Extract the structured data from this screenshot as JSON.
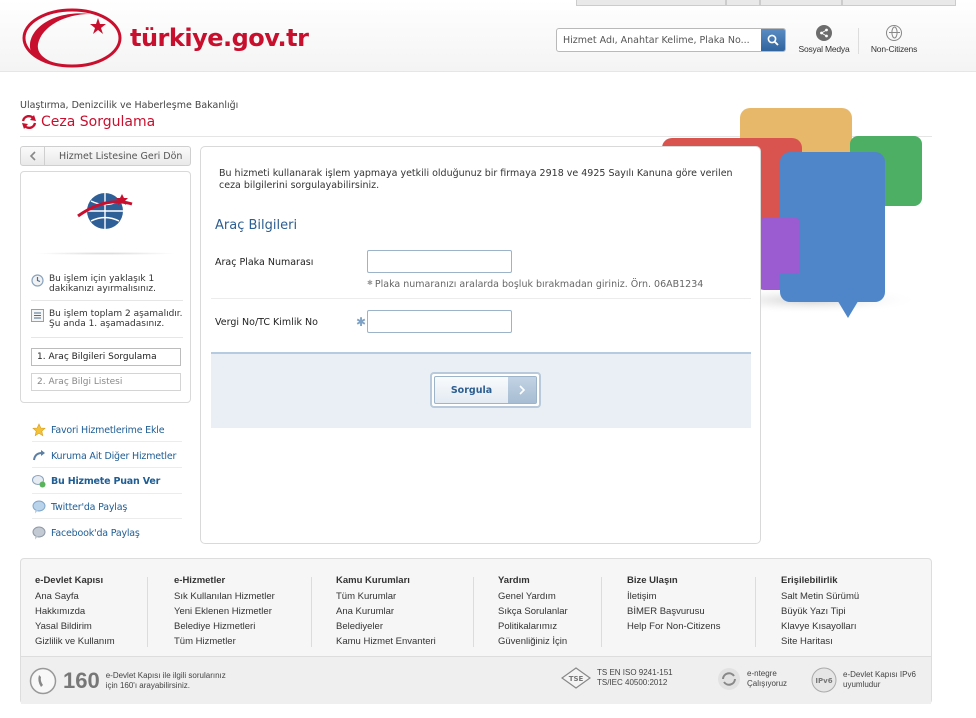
{
  "header": {
    "logo_text": "türkiye.gov.tr",
    "search_placeholder": "Hizmet Adı, Anahtar Kelime, Plaka No...",
    "social_label": "Sosyal Medya",
    "noncitizens_label": "Non-Citizens"
  },
  "page": {
    "ministry": "Ulaştırma, Denizcilik ve Haberleşme Bakanlığı",
    "title": "Ceza Sorgulama"
  },
  "sidebar": {
    "back_label": "Hizmet Listesine Geri Dön",
    "time_info": "Bu işlem için yaklaşık 1 dakikanızı ayırmalısınız.",
    "steps_info": "Bu işlem toplam 2 aşamalıdır. Şu anda 1. aşamadasınız.",
    "steps": [
      "1.  Araç Bilgileri Sorgulama",
      "2.  Araç Bilgi Listesi"
    ],
    "links": [
      "Favori Hizmetlerime Ekle",
      "Kuruma Ait Diğer Hizmetler",
      "Bu Hizmete Puan Ver",
      "Twitter'da Paylaş",
      "Facebook'da Paylaş"
    ]
  },
  "form": {
    "intro": "Bu hizmeti kullanarak işlem yapmaya yetkili olduğunuz bir firmaya 2918 ve 4925 Sayılı Kanuna göre verilen ceza bilgilerini sorgulayabilirsiniz.",
    "section_title": "Araç Bilgileri",
    "plate_label": "Araç Plaka Numarası",
    "plate_value": "",
    "plate_hint": "Plaka numaranızı aralarda boşluk bırakmadan giriniz. Örn. 06AB1234",
    "tax_label": "Vergi No/TC Kimlik No",
    "tax_value": "",
    "submit_label": "Sorgula"
  },
  "footer": {
    "columns": [
      {
        "title": "e-Devlet Kapısı",
        "links": [
          "Ana Sayfa",
          "Hakkımızda",
          "Yasal Bildirim",
          "Gizlilik ve Kullanım"
        ]
      },
      {
        "title": "e-Hizmetler",
        "links": [
          "Sık Kullanılan Hizmetler",
          "Yeni Eklenen Hizmetler",
          "Belediye Hizmetleri",
          "Tüm Hizmetler"
        ]
      },
      {
        "title": "Kamu Kurumları",
        "links": [
          "Tüm Kurumlar",
          "Ana Kurumlar",
          "Belediyeler",
          "Kamu Hizmet Envanteri"
        ]
      },
      {
        "title": "Yardım",
        "links": [
          "Genel Yardım",
          "Sıkça Sorulanlar",
          "Politikalarımız",
          "Güvenliğiniz İçin"
        ]
      },
      {
        "title": "Bize Ulaşın",
        "links": [
          "İletişim",
          "BİMER Başvurusu",
          "Help For Non-Citizens"
        ]
      },
      {
        "title": "Erişilebilirlik",
        "links": [
          "Salt Metin Sürümü",
          "Büyük Yazı Tipi",
          "Klavye Kısayolları",
          "Site Haritası"
        ]
      }
    ],
    "callcenter_number": "160",
    "callcenter_line1": "e-Devlet Kapısı ile ilgili sorularınız",
    "callcenter_line2": "için 160'ı arayabilirsiniz.",
    "iso_line1": "TS EN ISO 9241-151",
    "iso_line2": "TS/IEC 40500:2012",
    "integrated_line1": "e-ntegre",
    "integrated_line2": "Çalışıyoruz",
    "ipv6_line1": "e-Devlet Kapısı IPv6",
    "ipv6_line2": "uyumludur"
  },
  "colors": {
    "brand_red": "#c8102e",
    "link_blue": "#1f5d93",
    "heading_blue": "#2c5e91"
  }
}
